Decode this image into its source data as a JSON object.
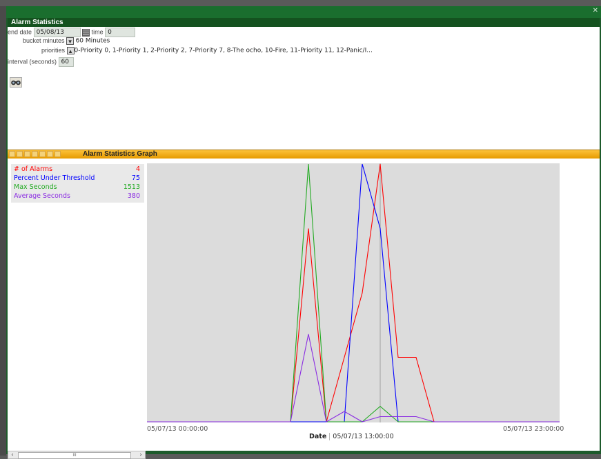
{
  "window": {
    "close_glyph": "✕",
    "panel_title": "Alarm Statistics"
  },
  "form": {
    "end_date_label": "end date",
    "end_date_value": "05/08/13",
    "time_label": "time",
    "time_value": "0",
    "bucket_label": "bucket minutes",
    "bucket_value": "60 Minutes",
    "priorities_label": "priorities",
    "priorities_value": "0-Priority 0, 1-Priority 1, 2-Priority 2, 7-Priority 7, 8-The ocho, 10-Fire, 11-Priority 11, 12-Panic/I...",
    "interval_label": "interval (seconds)",
    "interval_value": "60",
    "search_icon": "binoculars-icon"
  },
  "graph": {
    "title": "Alarm Statistics Graph",
    "legend": [
      {
        "label": "# of Alarms",
        "value": "4",
        "color": "#ff0000"
      },
      {
        "label": "Percent Under Threshold",
        "value": "75",
        "color": "#0000ff"
      },
      {
        "label": "Max Seconds",
        "value": "1513",
        "color": "#22aa22"
      },
      {
        "label": "Average Seconds",
        "value": "380",
        "color": "#8a2be2"
      }
    ],
    "x_start_label": "05/07/13 00:00:00",
    "x_end_label": "05/07/13 23:00:00",
    "date_label": "Date",
    "selected_date": "05/07/13 13:00:00"
  },
  "chart_data": {
    "type": "line",
    "x": [
      "00",
      "01",
      "02",
      "03",
      "04",
      "05",
      "06",
      "07",
      "08",
      "09",
      "10",
      "11",
      "12",
      "13",
      "14",
      "15",
      "16",
      "17",
      "18",
      "19",
      "20",
      "21",
      "22",
      "23"
    ],
    "ylim": [
      0,
      1
    ],
    "series": [
      {
        "name": "# of Alarms",
        "color": "#ff0000",
        "values": [
          0,
          0,
          0,
          0,
          0,
          0,
          0,
          0,
          0,
          0.75,
          0,
          0.25,
          0.5,
          1,
          0.25,
          0.25,
          0,
          0,
          0,
          0,
          0,
          0,
          0,
          0
        ]
      },
      {
        "name": "Percent Under Threshold",
        "color": "#0000ff",
        "values": [
          0,
          0,
          0,
          0,
          0,
          0,
          0,
          0,
          0,
          0,
          0,
          0,
          1,
          0.75,
          0,
          0,
          0,
          0,
          0,
          0,
          0,
          0,
          0,
          0
        ]
      },
      {
        "name": "Max Seconds",
        "color": "#22aa22",
        "values": [
          0,
          0,
          0,
          0,
          0,
          0,
          0,
          0,
          0,
          1,
          0,
          0,
          0,
          0.06,
          0,
          0,
          0,
          0,
          0,
          0,
          0,
          0,
          0,
          0
        ]
      },
      {
        "name": "Average Seconds",
        "color": "#8a2be2",
        "values": [
          0,
          0,
          0,
          0,
          0,
          0,
          0,
          0,
          0,
          0.34,
          0,
          0.04,
          0,
          0.02,
          0.02,
          0.02,
          0,
          0,
          0,
          0,
          0,
          0,
          0,
          0
        ]
      }
    ],
    "selected_index": 13
  },
  "scrollbar": {
    "left_arrow": "‹",
    "right_arrow": "›",
    "thumb_grip": "III"
  }
}
